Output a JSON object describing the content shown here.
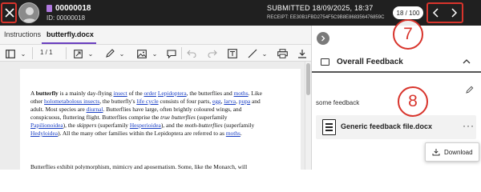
{
  "header": {
    "close_icon": "close-icon",
    "submission_id": "00000018",
    "id_line": "ID: 00000018",
    "submitted": "SUBMITTED 18/09/2025, 18:37",
    "receipt": "RECEIPT: EE30B1FBD2754F5C9B8E868356476859C",
    "counter": "18 / 100",
    "prev_icon": "chevron-left-icon",
    "next_icon": "chevron-right-icon"
  },
  "annotations": {
    "seven": "7",
    "eight": "8",
    "color": "#d8342c"
  },
  "tabs": [
    {
      "label": "Instructions"
    },
    {
      "label": "butterfly.docx"
    }
  ],
  "toolbar": {
    "page_indicator": "1 / 1"
  },
  "document": {
    "p1_intro": "A ",
    "p1_bold": "butterfly",
    "p1_a": " is a mainly day-flying ",
    "p1_insect": "insect",
    "p1_b": " of the ",
    "p1_order": "order",
    "p1_c": " ",
    "p1_lepidoptera": "Lepidoptera",
    "p1_d": ", the butterflies and ",
    "p1_moths": "moths",
    "p1_e": ". Like other ",
    "p1_holo": "holometabolous insects",
    "p1_f": ", the butterfly's ",
    "p1_lifecycle": "life cycle",
    "p1_g": " consists of four parts, ",
    "p1_egg": "egg",
    "p1_h": ", ",
    "p1_larva": "larva",
    "p1_i": ", ",
    "p1_pupa": "pupa",
    "p1_j": " and adult. Most species are ",
    "p1_diurnal": "diurnal",
    "p1_k": ". Butterflies have large, often brightly coloured wings, and conspicuous, fluttering flight. Butterflies comprise the ",
    "p1_true": "true butterflies",
    "p1_l": " (superfamily ",
    "p1_papil": "Papilionoidea",
    "p1_m": "), the ",
    "p1_skippers": "skippers",
    "p1_n": " (superfamily ",
    "p1_hesper": "Hesperioidea",
    "p1_o": "), and the ",
    "p1_mothbutter": "moth-butterflies",
    "p1_p": " (superfamily ",
    "p1_hedyl": "Hedyloidea",
    "p1_q": "). All the many other families within the Lepidoptera are referred to as ",
    "p1_moths2": "moths",
    "p1_r": ".",
    "p2_partial": "Butterflies exhibit polymorphism, mimicry and aposematism. Some, like the Monarch, will"
  },
  "panel": {
    "collapse_icon": "chevron-right-icon",
    "feedback_title": "Overall Feedback",
    "feedback_text": "some feedback",
    "file_name": "Generic feedback file.docx",
    "download_label": "Download"
  }
}
